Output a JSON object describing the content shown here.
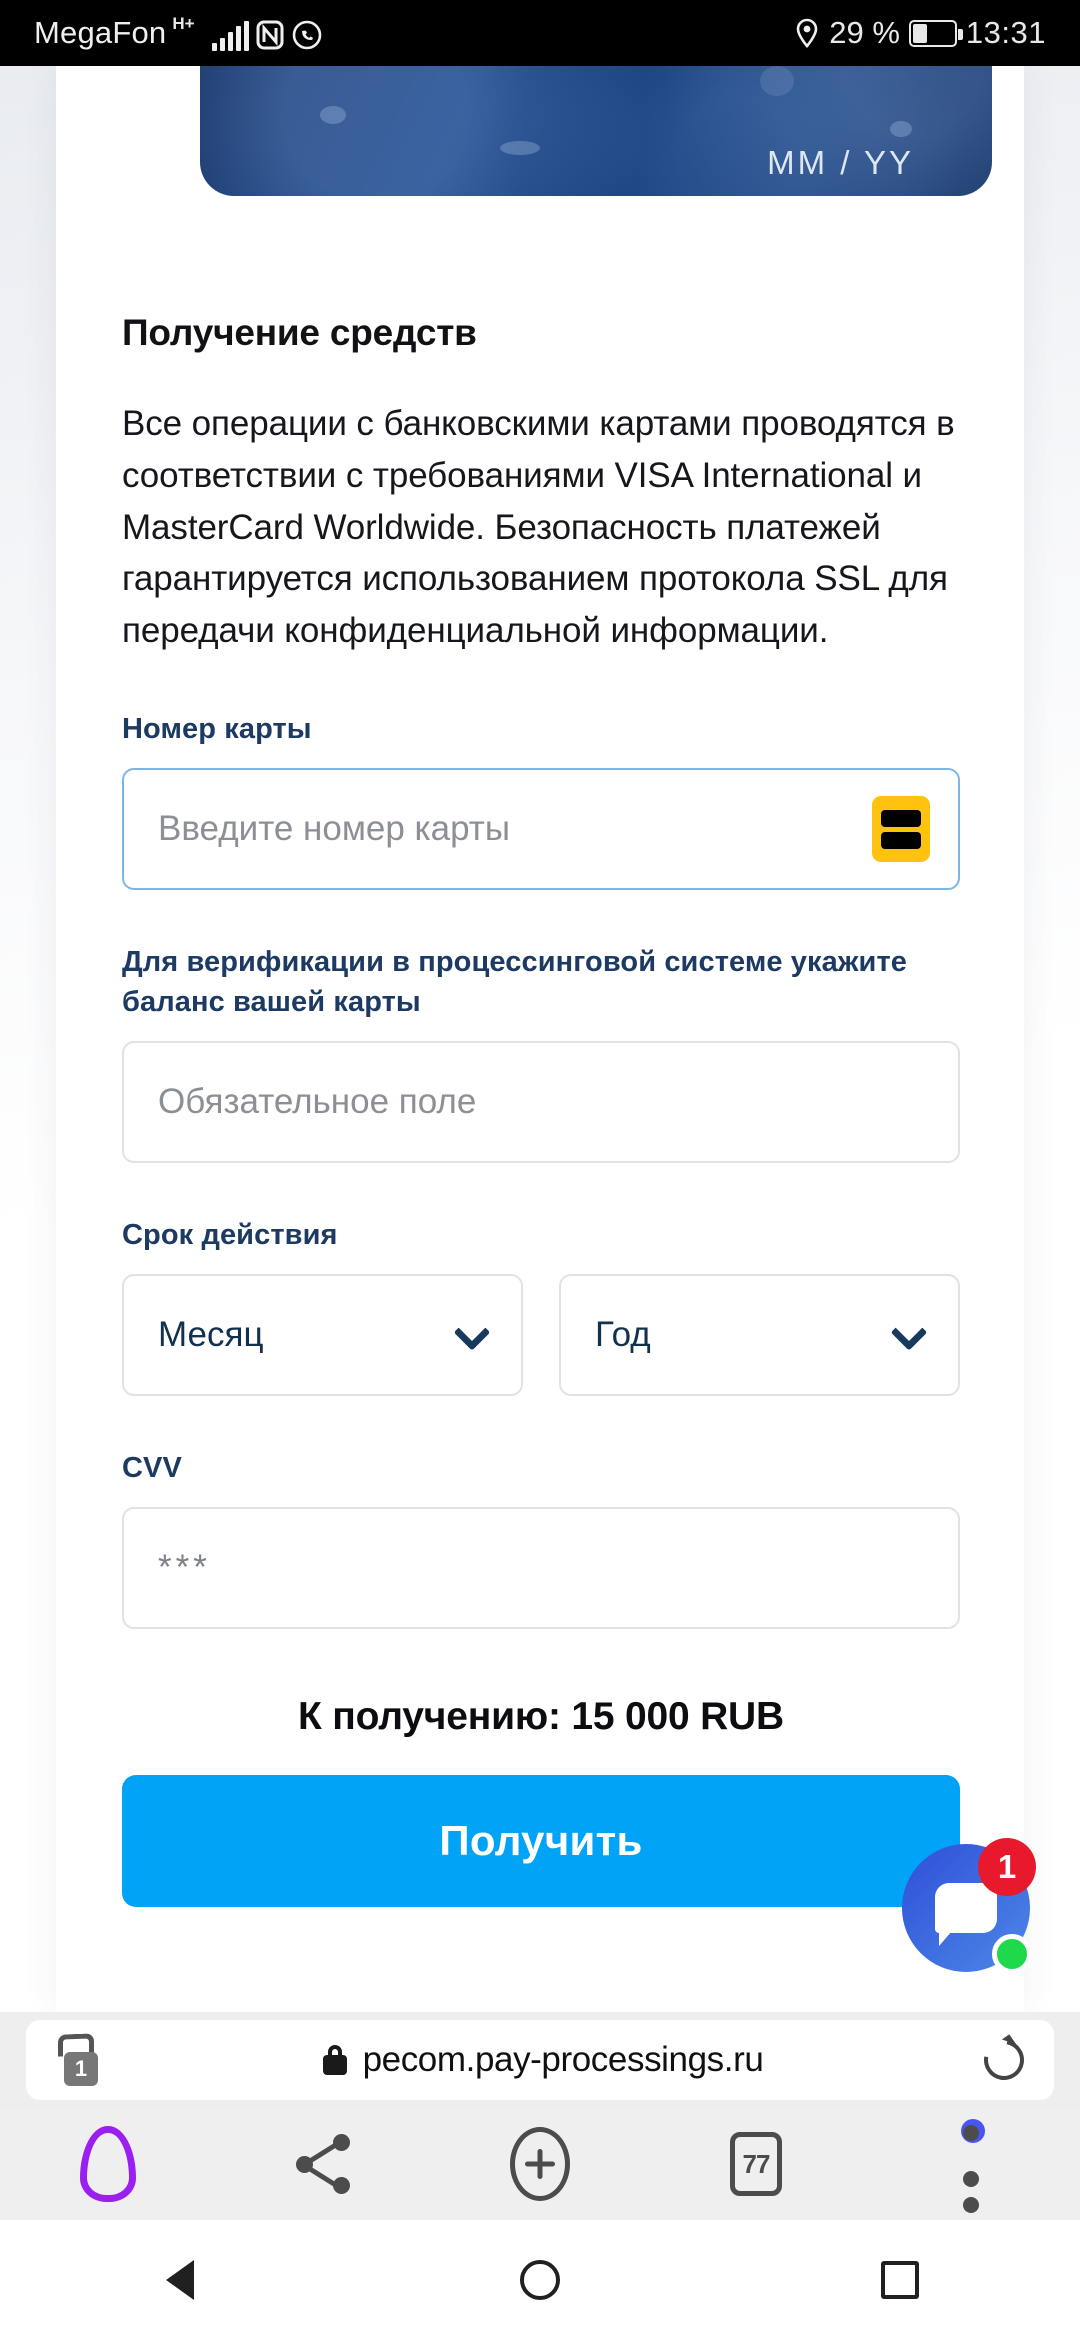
{
  "status_bar": {
    "carrier": "MegaFon",
    "network_type": "H+",
    "signal_icon": "signal-bars-icon",
    "nfc_icon": "nfc-icon",
    "whatsapp_icon": "whatsapp-icon",
    "location_icon": "location-pin-icon",
    "battery_percent": "29 %",
    "battery_icon": "battery-icon",
    "time": "13:31"
  },
  "card_visual": {
    "expiry_hint": "MM / YY"
  },
  "page": {
    "section_title": "Получение средств",
    "intro": "Все операции с банковскими картами проводятся в соответствии с требованиями VISA International и MasterCard Worldwide. Безопасность платежей гарантируется использованием протокола SSL для передачи конфиденциальной информации.",
    "card_number": {
      "label": "Номер карты",
      "placeholder": "Введите номер карты",
      "value": "",
      "brand_icon": "card-brand-icon"
    },
    "balance": {
      "label": "Для верификации в процессинговой системе укажите баланс вашей карты",
      "placeholder": "Обязательное поле",
      "value": ""
    },
    "expiry": {
      "label": "Срок действия",
      "month_value": "Месяц",
      "year_value": "Год",
      "chevron_icon": "chevron-down-icon"
    },
    "cvv": {
      "label": "CVV",
      "placeholder": "***",
      "value": ""
    },
    "total_text": "К получению: 15 000 RUB",
    "submit_label": "Получить"
  },
  "chat_widget": {
    "icon": "chat-bubble-icon",
    "badge_count": "1",
    "online_indicator": "online-dot"
  },
  "browser": {
    "tab_count": "1",
    "lock_icon": "lock-icon",
    "url": "pecom.pay-processings.ru",
    "reload_icon": "reload-icon",
    "toolbar": {
      "home_icon": "home-icon",
      "share_icon": "share-icon",
      "new_tab_icon": "plus-circle-icon",
      "tabs_icon": "tabs-icon",
      "tabs_label": "77",
      "menu_icon": "overflow-menu-icon"
    }
  },
  "nav_bar": {
    "back_icon": "back-triangle-icon",
    "home_icon": "home-circle-icon",
    "recents_icon": "recents-square-icon"
  },
  "colors": {
    "accent": "#00a3f5",
    "label_blue": "#1d3a63",
    "badge_red": "#e8192c",
    "online_green": "#1ed94a",
    "card_brand_yellow": "#ffc20e",
    "home_purple": "#9b1ff0"
  }
}
